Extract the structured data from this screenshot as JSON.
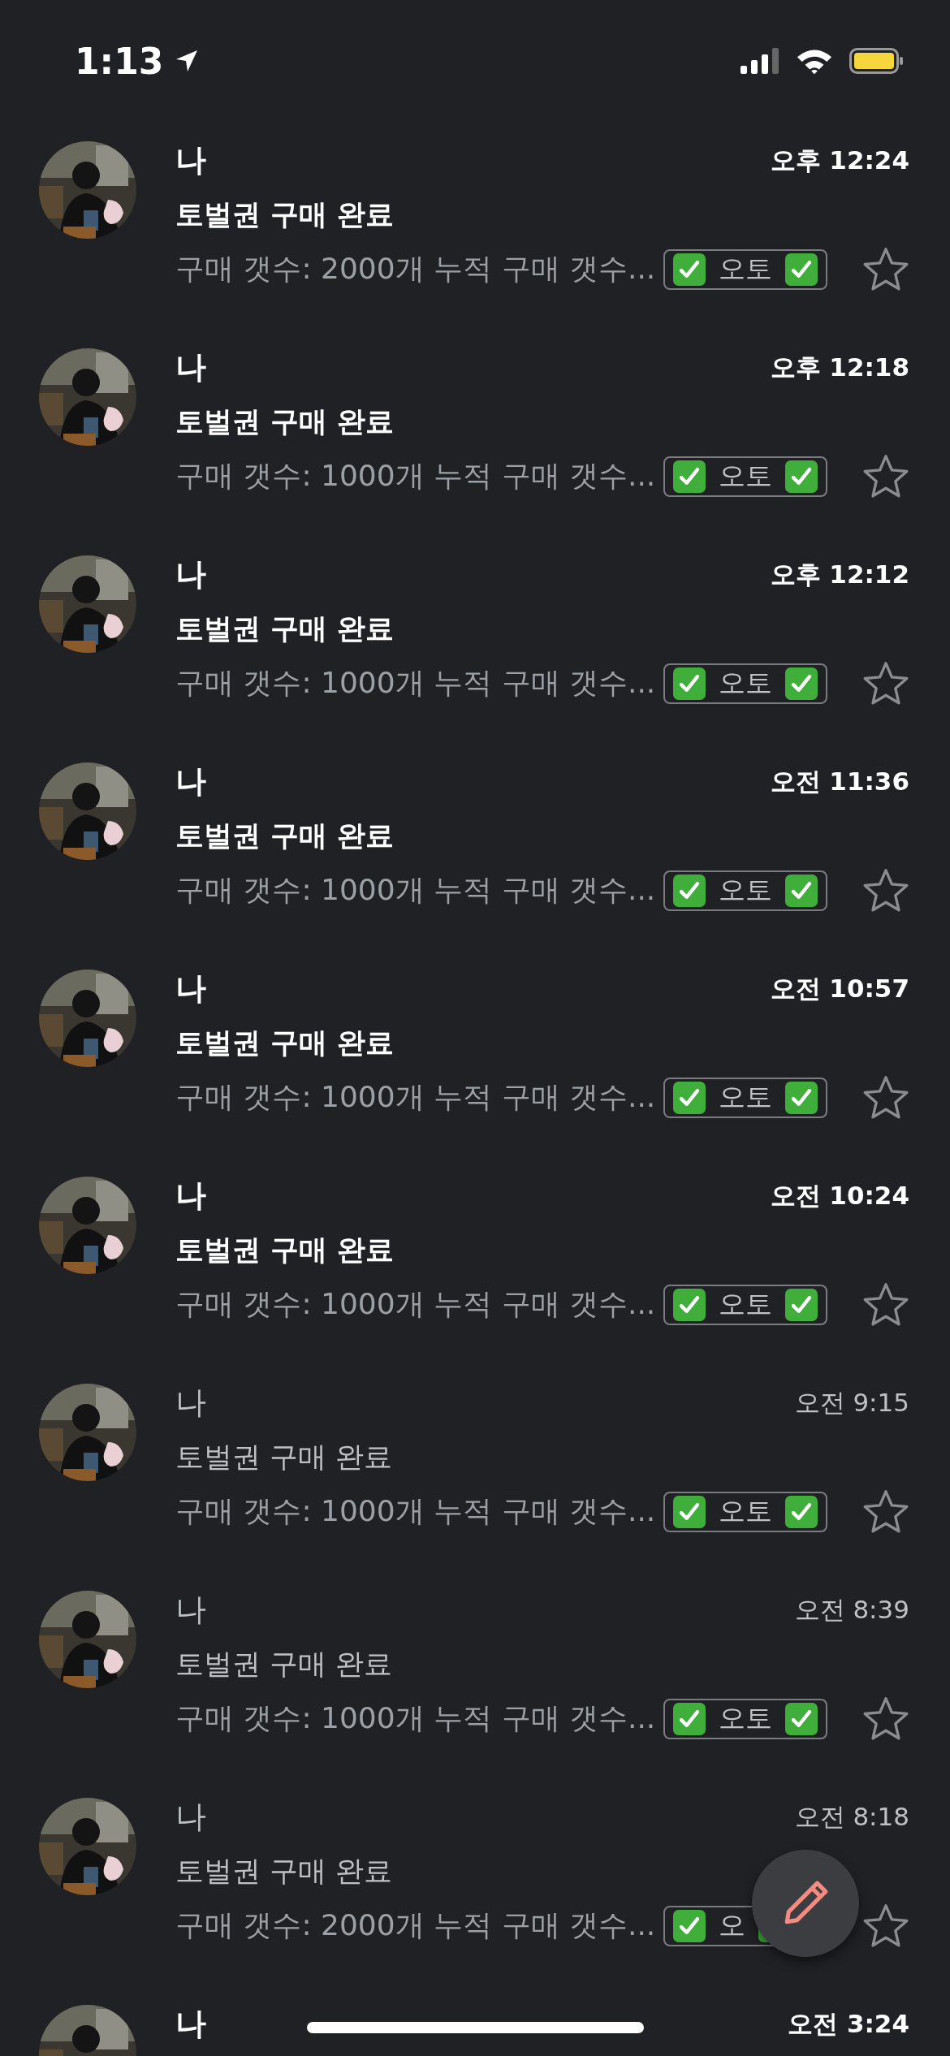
{
  "status_bar": {
    "time": "1:13"
  },
  "messages": [
    {
      "kind": "full",
      "sender": "나",
      "time": "오후 12:24",
      "subject": "토벌권 구매 완료",
      "snippet": "구매 갯수: 2000개 누적 구매 갯수...",
      "tag": "오토",
      "unread": true,
      "starred": false
    },
    {
      "kind": "full",
      "sender": "나",
      "time": "오후 12:18",
      "subject": "토벌권 구매 완료",
      "snippet": "구매 갯수: 1000개 누적 구매 갯수...",
      "tag": "오토",
      "unread": true,
      "starred": false
    },
    {
      "kind": "full",
      "sender": "나",
      "time": "오후 12:12",
      "subject": "토벌권 구매 완료",
      "snippet": "구매 갯수: 1000개 누적 구매 갯수...",
      "tag": "오토",
      "unread": true,
      "starred": false
    },
    {
      "kind": "full",
      "sender": "나",
      "time": "오전 11:36",
      "subject": "토벌권 구매 완료",
      "snippet": "구매 갯수: 1000개 누적 구매 갯수...",
      "tag": "오토",
      "unread": true,
      "starred": false
    },
    {
      "kind": "full",
      "sender": "나",
      "time": "오전 10:57",
      "subject": "토벌권 구매 완료",
      "snippet": "구매 갯수: 1000개 누적 구매 갯수...",
      "tag": "오토",
      "unread": true,
      "starred": false
    },
    {
      "kind": "full",
      "sender": "나",
      "time": "오전 10:24",
      "subject": "토벌권 구매 완료",
      "snippet": "구매 갯수: 1000개 누적 구매 갯수...",
      "tag": "오토",
      "unread": true,
      "starred": false
    },
    {
      "kind": "full",
      "sender": "나",
      "time": "오전 9:15",
      "subject": "토벌권 구매 완료",
      "snippet": "구매 갯수: 1000개 누적 구매 갯수...",
      "tag": "오토",
      "unread": false,
      "starred": false
    },
    {
      "kind": "full",
      "sender": "나",
      "time": "오전 8:39",
      "subject": "토벌권 구매 완료",
      "snippet": "구매 갯수: 1000개 누적 구매 갯수...",
      "tag": "오토",
      "unread": false,
      "starred": false
    },
    {
      "kind": "full",
      "sender": "나",
      "time": "오전 8:18",
      "subject": "토벌권 구매 완료",
      "snippet": "구매 갯수: 2000개 누적 구매 갯수...",
      "tag": "오",
      "unread": false,
      "starred": false
    },
    {
      "kind": "head",
      "sender": "나",
      "time": "오전 3:24",
      "unread": true
    }
  ]
}
